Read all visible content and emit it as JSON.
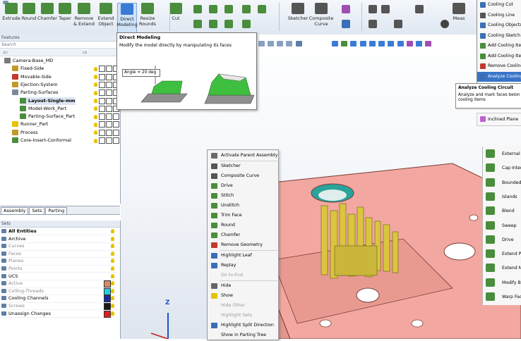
{
  "ribbon": {
    "buttons": [
      {
        "label": "Extrude",
        "color": "#4a8d3c"
      },
      {
        "label": "Round",
        "color": "#4a8d3c"
      },
      {
        "label": "Chamfer",
        "color": "#4a8d3c"
      },
      {
        "label": "Taper",
        "color": "#4a8d3c"
      },
      {
        "label": "Remove & Extend",
        "color": "#4a8d3c"
      },
      {
        "label": "Extend Object",
        "color": "#4a8d3c"
      },
      {
        "label": "Direct Modeling",
        "color": "#3a7bd5"
      },
      {
        "label": "Resize Rounds",
        "color": "#4a8d3c"
      },
      {
        "label": "Cut",
        "color": "#4a8d3c"
      },
      {
        "label": "Sketcher",
        "color": "#555555"
      },
      {
        "label": "Composite Curve",
        "color": "#555555"
      },
      {
        "label": "Meas",
        "color": "#555555"
      }
    ]
  },
  "tooltip": {
    "title": "Direct Modeling",
    "description": "Modify the model directly by manipulating its faces",
    "angle_label": "Angle = 20 deg"
  },
  "features_panel": {
    "title": "Features",
    "search_placeholder": "Search",
    "tree": [
      {
        "label": "Camera-Base_MD",
        "level": 0,
        "bold": false
      },
      {
        "label": "Fixed-Side",
        "level": 1,
        "bold": false
      },
      {
        "label": "Movable-Side",
        "level": 1,
        "bold": false
      },
      {
        "label": "Ejection-System",
        "level": 1,
        "bold": false
      },
      {
        "label": "Parting-Surfaces",
        "level": 1,
        "bold": false
      },
      {
        "label": "Layout-Single-mm",
        "level": 2,
        "bold": true
      },
      {
        "label": "Model-Work_Part",
        "level": 2,
        "bold": false
      },
      {
        "label": "Parting-Surface_Part",
        "level": 2,
        "bold": false
      },
      {
        "label": "Runner_Part",
        "level": 1,
        "bold": false
      },
      {
        "label": "Process",
        "level": 1,
        "bold": false
      },
      {
        "label": "Core-Insert-Conformal",
        "level": 1,
        "bold": false
      }
    ]
  },
  "bottom_tabs": [
    "Assembly",
    "Sets",
    "Parting"
  ],
  "sets_panel": {
    "title": "Sets",
    "items": [
      {
        "label": "All Entities",
        "bold": true,
        "gray": false,
        "swatch": ""
      },
      {
        "label": "Archive",
        "bold": false,
        "gray": false,
        "swatch": ""
      },
      {
        "label": "Curves",
        "bold": false,
        "gray": true,
        "swatch": ""
      },
      {
        "label": "Faces",
        "bold": false,
        "gray": true,
        "swatch": ""
      },
      {
        "label": "Planes",
        "bold": false,
        "gray": true,
        "swatch": ""
      },
      {
        "label": "Points",
        "bold": false,
        "gray": true,
        "swatch": ""
      },
      {
        "label": "UCS",
        "bold": false,
        "gray": false,
        "swatch": ""
      },
      {
        "label": "Active",
        "bold": false,
        "gray": true,
        "swatch": "#d98c5f"
      },
      {
        "label": "Colling-Threads",
        "bold": false,
        "gray": true,
        "swatch": "#1fd0e6"
      },
      {
        "label": "Cooling Channels",
        "bold": false,
        "gray": false,
        "swatch": "#1a2a9e"
      },
      {
        "label": "Screws",
        "bold": false,
        "gray": true,
        "swatch": "#1a1a1a"
      },
      {
        "label": "Unassign Changes",
        "bold": false,
        "gray": false,
        "swatch": "#e21b1b"
      }
    ]
  },
  "context_menu": {
    "items": [
      {
        "label": "Activate Parent Assembly",
        "disabled": false,
        "icon": "#6a6a6a",
        "sep_after": true
      },
      {
        "label": "Sketcher",
        "disabled": false,
        "icon": "#555555",
        "sep_after": false
      },
      {
        "label": "Composite Curve",
        "disabled": false,
        "icon": "#555555",
        "sep_after": false
      },
      {
        "label": "Drive",
        "disabled": false,
        "icon": "#4a8d3c",
        "sep_after": false
      },
      {
        "label": "Stitch",
        "disabled": false,
        "icon": "#4a8d3c",
        "sep_after": false
      },
      {
        "label": "Unstitch",
        "disabled": false,
        "icon": "#4a8d3c",
        "sep_after": false
      },
      {
        "label": "Trim Face",
        "disabled": false,
        "icon": "#4a8d3c",
        "sep_after": false
      },
      {
        "label": "Round",
        "disabled": false,
        "icon": "#4a8d3c",
        "sep_after": false
      },
      {
        "label": "Chamfer",
        "disabled": false,
        "icon": "#4a8d3c",
        "sep_after": false
      },
      {
        "label": "Remove Geometry",
        "disabled": false,
        "icon": "#c0392b",
        "sep_after": true
      },
      {
        "label": "Highlight Leaf",
        "disabled": false,
        "icon": "#3a6fb5",
        "sep_after": false
      },
      {
        "label": "Replay",
        "disabled": false,
        "icon": "#3a6fb5",
        "sep_after": false
      },
      {
        "label": "Go to End",
        "disabled": true,
        "icon": "",
        "sep_after": true
      },
      {
        "label": "Hide",
        "disabled": false,
        "icon": "#666666",
        "sep_after": false
      },
      {
        "label": "Show",
        "disabled": false,
        "icon": "#e6c200",
        "sep_after": false
      },
      {
        "label": "Hide Other",
        "disabled": true,
        "icon": "",
        "sep_after": false
      },
      {
        "label": "Highlight Sets",
        "disabled": true,
        "icon": "",
        "sep_after": false
      },
      {
        "label": "Highlight Split Direction",
        "disabled": false,
        "icon": "#3a6fb5",
        "sep_after": false
      },
      {
        "label": "Show in Parting Tree",
        "disabled": false,
        "icon": "",
        "sep_after": false
      }
    ]
  },
  "cooling_dropdown": {
    "items": [
      {
        "label": "Cooling Cut",
        "selected": false
      },
      {
        "label": "Cooling Line",
        "selected": false
      },
      {
        "label": "Cooling Objects",
        "selected": false
      },
      {
        "label": "Cooling Sketch",
        "selected": false
      },
      {
        "label": "Add Cooling Ite",
        "selected": false
      },
      {
        "label": "Add Cooling Ite",
        "selected": false
      },
      {
        "label": "Remove Cooling",
        "selected": false
      },
      {
        "label": "Analyze Cooling",
        "selected": true
      }
    ],
    "tooltip_title": "Analyze Cooling Circuit",
    "tooltip_text": "Analyze and mark faces belon cooling items",
    "inclined_plane": "Inclined Plane"
  },
  "right_panel": {
    "items": [
      {
        "label": "External",
        "color": "#4a8d3c"
      },
      {
        "label": "Cap Inter",
        "color": "#4a8d3c"
      },
      {
        "label": "Bounded",
        "color": "#4a8d3c"
      },
      {
        "label": "Islands",
        "color": "#4a8d3c"
      },
      {
        "label": "Blend",
        "color": "#4a8d3c"
      },
      {
        "label": "Sweep",
        "color": "#4a8d3c"
      },
      {
        "label": "Drive",
        "color": "#4a8d3c"
      },
      {
        "label": "Extend P",
        "color": "#4a8d3c"
      },
      {
        "label": "Extend N",
        "color": "#4a8d3c"
      },
      {
        "label": "Modify B",
        "color": "#4a8d3c"
      },
      {
        "label": "Warp Fac",
        "color": "#4a8d3c"
      }
    ]
  },
  "axis_label": "Z",
  "colors": {
    "part_pink": "#f2a8a0",
    "part_edge": "#7a3b35",
    "pin_yellow": "#d9c63e",
    "hole_teal": "#2aa39a",
    "selection_blue": "#3874c8"
  }
}
